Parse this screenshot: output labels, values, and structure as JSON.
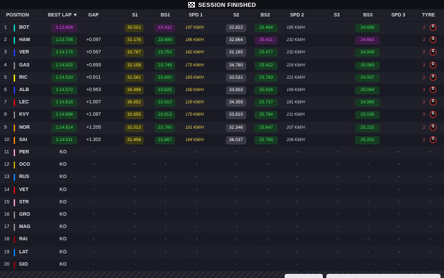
{
  "top_bar": {
    "title": "SESSION FINISHED",
    "flag_icon": "checkered-flag-icon"
  },
  "columns": {
    "position": "POSITION",
    "best_lap": "BEST LAP",
    "gap": "GAP",
    "s1": "S1",
    "bs1": "BS1",
    "spd1": "SPD 1",
    "s2": "S2",
    "bs2": "BS2",
    "spd2": "SPD 2",
    "s3": "S3",
    "bs3": "BS3",
    "spd3": "SPD 3",
    "tyre": "TYRE"
  },
  "pill_colors": {
    "purple": "#e05cf0",
    "green": "#41e05a",
    "yellow": "#f0e03a",
    "white": "#ffffff"
  },
  "rows": [
    {
      "pos": "1",
      "name": "BOT",
      "team": "#00d2be",
      "best": "1:13.609",
      "best_c": "purple",
      "gap": "",
      "s1": "30.501",
      "s1_c": "yellow",
      "bs1": "23.432",
      "bs1_c": "purple",
      "spd1": "197 KM/H",
      "s2": "32.822",
      "s2_c": "white",
      "bs2": "25.464",
      "bs2_c": "green",
      "spd2": "185 KM/H",
      "s3": "",
      "bs3": "24.699",
      "bs3_c": "green",
      "spd3": "",
      "tyre_num": "2",
      "tyre": "S"
    },
    {
      "pos": "2",
      "name": "HAM",
      "team": "#00d2be",
      "best": "1:13.706",
      "best_c": "green",
      "gap": "+0.097",
      "s1": "31.176",
      "s1_c": "yellow",
      "bs1": "23.488",
      "bs1_c": "green",
      "spd1": "186 KM/H",
      "s2": "32.864",
      "s2_c": "white",
      "bs2": "25.411",
      "bs2_c": "purple",
      "spd2": "232 KM/H",
      "s3": "",
      "bs3": "24.683",
      "bs3_c": "purple",
      "spd3": "",
      "tyre_num": "2",
      "tyre": "S"
    },
    {
      "pos": "3",
      "name": "VER",
      "team": "#1e41ff",
      "best": "1:14.176",
      "best_c": "green",
      "gap": "+0.567",
      "s1": "33.767",
      "s1_c": "yellow",
      "bs1": "23.750",
      "bs1_c": "green",
      "spd1": "162 KM/H",
      "s2": "31.165",
      "s2_c": "white",
      "bs2": "25.477",
      "bs2_c": "green",
      "spd2": "232 KM/H",
      "s3": "",
      "bs3": "24.949",
      "bs3_c": "green",
      "spd3": "",
      "tyre_num": "2",
      "tyre": "S"
    },
    {
      "pos": "4",
      "name": "GAS",
      "team": "#8a8a8a",
      "best": "1:14.502",
      "best_c": "green",
      "gap": "+0.893",
      "s1": "32.158",
      "s1_c": "yellow",
      "bs1": "23.749",
      "bs1_c": "green",
      "spd1": "175 KM/H",
      "s2": "34.780",
      "s2_c": "white",
      "bs2": "25.612",
      "bs2_c": "green",
      "spd2": "229 KM/H",
      "s3": "",
      "bs3": "25.069",
      "bs3_c": "green",
      "spd3": "",
      "tyre_num": "2",
      "tyre": "S"
    },
    {
      "pos": "5",
      "name": "RIC",
      "team": "#fff500",
      "best": "1:14.520",
      "best_c": "green",
      "gap": "+0.911",
      "s1": "31.561",
      "s1_c": "yellow",
      "bs1": "23.800",
      "bs1_c": "green",
      "spd1": "183 KM/H",
      "s2": "33.531",
      "s2_c": "white",
      "bs2": "25.783",
      "bs2_c": "green",
      "spd2": "221 KM/H",
      "s3": "",
      "bs3": "24.937",
      "bs3_c": "green",
      "spd3": "",
      "tyre_num": "2",
      "tyre": "S"
    },
    {
      "pos": "6",
      "name": "ALB",
      "team": "#1e41ff",
      "best": "1:14.572",
      "best_c": "green",
      "gap": "+0.963",
      "s1": "30.498",
      "s1_c": "yellow",
      "bs1": "23.825",
      "bs1_c": "green",
      "spd1": "169 KM/H",
      "s2": "33.803",
      "s2_c": "white",
      "bs2": "25.616",
      "bs2_c": "green",
      "spd2": "199 KM/H",
      "s3": "",
      "bs3": "25.084",
      "bs3_c": "green",
      "spd3": "",
      "tyre_num": "2",
      "tyre": "S"
    },
    {
      "pos": "7",
      "name": "LEC",
      "team": "#dc0000",
      "best": "1:14.616",
      "best_c": "green",
      "gap": "+1.007",
      "s1": "36.852",
      "s1_c": "yellow",
      "bs1": "23.910",
      "bs1_c": "green",
      "spd1": "129 KM/H",
      "s2": "34.359",
      "s2_c": "white",
      "bs2": "25.737",
      "bs2_c": "green",
      "spd2": "181 KM/H",
      "s3": "",
      "bs3": "24.969",
      "bs3_c": "green",
      "spd3": "",
      "tyre_num": "2",
      "tyre": "S"
    },
    {
      "pos": "8",
      "name": "KVY",
      "team": "#8a8a8a",
      "best": "1:14.696",
      "best_c": "green",
      "gap": "+1.087",
      "s1": "32.855",
      "s1_c": "yellow",
      "bs1": "23.813",
      "bs1_c": "green",
      "spd1": "170 KM/H",
      "s2": "33.810",
      "s2_c": "white",
      "bs2": "25.784",
      "bs2_c": "green",
      "spd2": "211 KM/H",
      "s3": "",
      "bs3": "25.036",
      "bs3_c": "green",
      "spd3": "",
      "tyre_num": "2",
      "tyre": "S"
    },
    {
      "pos": "9",
      "name": "NOR",
      "team": "#ff8700",
      "best": "1:14.814",
      "best_c": "green",
      "gap": "+1.205",
      "s1": "31.013",
      "s1_c": "yellow",
      "bs1": "23.790",
      "bs1_c": "green",
      "spd1": "191 KM/H",
      "s2": "32.346",
      "s2_c": "white",
      "bs2": "25.647",
      "bs2_c": "green",
      "spd2": "207 KM/H",
      "s3": "",
      "bs3": "25.225",
      "bs3_c": "green",
      "spd3": "",
      "tyre_num": "2",
      "tyre": "S"
    },
    {
      "pos": "10",
      "name": "SAI",
      "team": "#ff8700",
      "best": "1:14.911",
      "best_c": "green",
      "gap": "+1.302",
      "s1": "31.456",
      "s1_c": "yellow",
      "bs1": "23.867",
      "bs1_c": "green",
      "spd1": "164 KM/H",
      "s2": "36.037",
      "s2_c": "white",
      "bs2": "25.766",
      "bs2_c": "green",
      "spd2": "206 KM/H",
      "s3": "",
      "bs3": "25.202",
      "bs3_c": "green",
      "spd3": "",
      "tyre_num": "2",
      "tyre": "S"
    }
  ],
  "ko_rows": [
    {
      "pos": "11",
      "name": "PER",
      "team": "#f596c8",
      "status": "KO"
    },
    {
      "pos": "12",
      "name": "OCO",
      "team": "#c8a000",
      "status": "KO"
    },
    {
      "pos": "13",
      "name": "RUS",
      "team": "#0082fa",
      "status": "KO"
    },
    {
      "pos": "14",
      "name": "VET",
      "team": "#dc0000",
      "status": "KO"
    },
    {
      "pos": "15",
      "name": "STR",
      "team": "#f596c8",
      "status": "KO"
    },
    {
      "pos": "16",
      "name": "GRO",
      "team": "#8a8a8a",
      "status": "KO"
    },
    {
      "pos": "17",
      "name": "MAG",
      "team": "#8a8a8a",
      "status": "KO"
    },
    {
      "pos": "18",
      "name": "RAI",
      "team": "#9b0000",
      "status": "KO"
    },
    {
      "pos": "19",
      "name": "LAT",
      "team": "#0082fa",
      "status": "KO"
    },
    {
      "pos": "20",
      "name": "GIO",
      "team": "#9b0000",
      "status": "KO"
    }
  ],
  "empty_value": "-"
}
